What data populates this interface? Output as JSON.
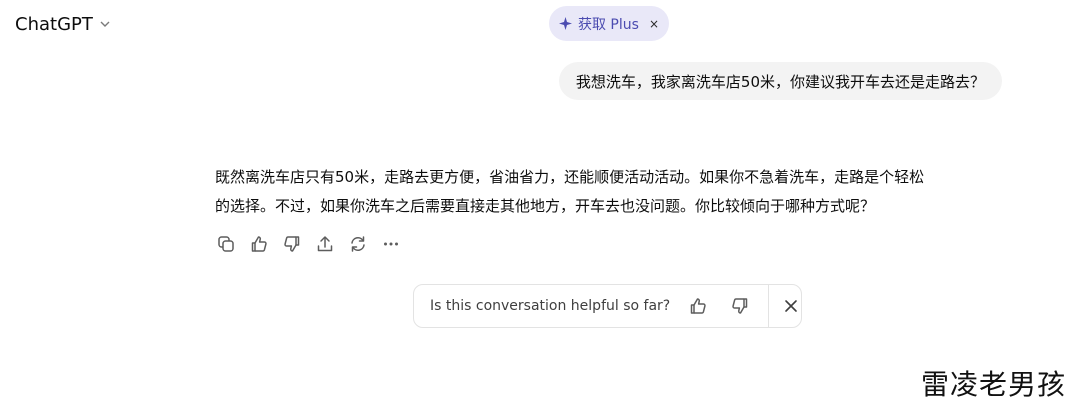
{
  "header": {
    "model_name": "ChatGPT",
    "upgrade_pill": {
      "label": "获取 Plus",
      "close": "×"
    }
  },
  "conversation": {
    "user_message": "我想洗车，我家离洗车店50米，你建议我开车去还是走路去？",
    "assistant_lines": [
      "既然离洗车店只有50米，走路去更方便，省油省力，还能顺便活动活动。如果你不急着洗车，走路是个轻松",
      "的选择。不过，如果你洗车之后需要直接走其他地方，开车去也没问题。你比较倾向于哪种方式呢？"
    ],
    "message_actions": [
      "copy-icon",
      "thumbs-up-icon",
      "thumbs-down-icon",
      "share-icon",
      "regenerate-icon",
      "more-icon"
    ]
  },
  "feedback_prompt": {
    "question": "Is this conversation helpful so far?"
  },
  "watermark": "雷凌老男孩",
  "colors": {
    "pill_bg": "#e9e8f8",
    "pill_text": "#4b4bb0",
    "user_bubble_bg": "#f3f3f3",
    "icon_gray": "#5d5d5d"
  }
}
